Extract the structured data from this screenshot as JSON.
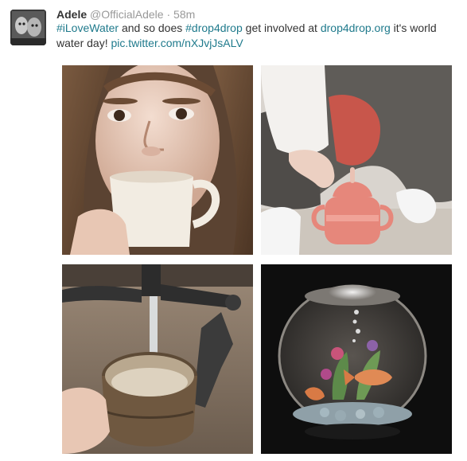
{
  "tweet": {
    "name": "Adele",
    "handle": "@OfficialAdele",
    "separator": "·",
    "time": "58m",
    "text_parts": {
      "hashtag1": "#iLoveWater",
      "t1": " and so does ",
      "hashtag2": "#drop4drop",
      "t2": " get involved at ",
      "link1": "drop4drop.org",
      "t3": " it's world water day! ",
      "link2": "pic.twitter.com/nXJvjJsALV"
    }
  },
  "photos": [
    {
      "name": "photo-woman-drinking-mug",
      "desc_icon": "photo"
    },
    {
      "name": "photo-toddler-sippy-cup",
      "desc_icon": "photo"
    },
    {
      "name": "photo-tap-filling-pot",
      "desc_icon": "photo"
    },
    {
      "name": "photo-fishbowl",
      "desc_icon": "photo"
    }
  ],
  "colors": {
    "link": "#1f7a8c",
    "muted": "#999999",
    "text": "#333333"
  }
}
